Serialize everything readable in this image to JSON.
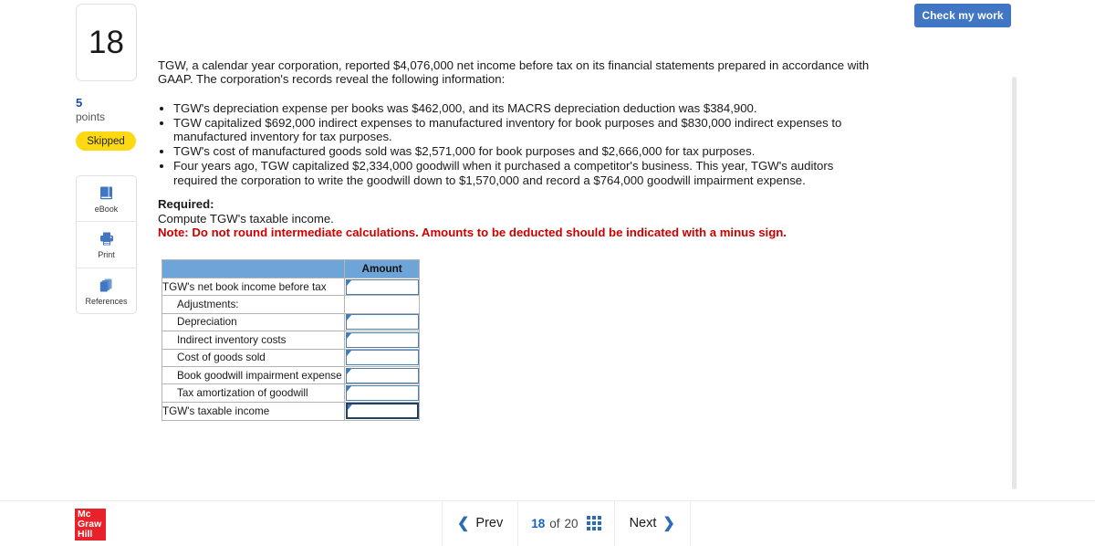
{
  "toolbar": {
    "check_work_label": "Check my work"
  },
  "question": {
    "number": "18",
    "points_value": "5",
    "points_label": "points",
    "status_badge": "Skipped"
  },
  "tools": [
    {
      "icon": "book-icon",
      "label": "eBook"
    },
    {
      "icon": "printer-icon",
      "label": "Print"
    },
    {
      "icon": "copy-pages-icon",
      "label": "References"
    }
  ],
  "content": {
    "intro": "TGW, a calendar year corporation, reported $4,076,000 net income before tax on its financial statements prepared in accordance with GAAP. The corporation's records reveal the following information:",
    "bullets": [
      "TGW's depreciation expense per books was $462,000, and its MACRS depreciation deduction was $384,900.",
      "TGW capitalized $692,000 indirect expenses to manufactured inventory for book purposes and $830,000 indirect expenses to manufactured inventory for tax purposes.",
      "TGW's cost of manufactured goods sold was $2,571,000 for book purposes and $2,666,000 for tax purposes.",
      "Four years ago, TGW capitalized $2,334,000 goodwill when it purchased a competitor's business. This year, TGW's auditors required the corporation to write the goodwill down to $1,570,000 and record a $764,000 goodwill impairment expense."
    ],
    "required_label": "Required:",
    "required_text": "Compute TGW's taxable income.",
    "note": "Note: Do not round intermediate calculations. Amounts to be deducted should be indicated with a minus sign."
  },
  "answer_table": {
    "header_blank": "",
    "header_amount": "Amount",
    "rows": [
      {
        "label": "TGW's net book income before tax",
        "indent": 0,
        "input": true,
        "value": "",
        "total": false
      },
      {
        "label": "Adjustments:",
        "indent": 1,
        "input": false,
        "value": "",
        "total": false
      },
      {
        "label": "Depreciation",
        "indent": 1,
        "input": true,
        "value": "",
        "total": false
      },
      {
        "label": "Indirect inventory costs",
        "indent": 1,
        "input": true,
        "value": "",
        "total": false
      },
      {
        "label": "Cost of goods sold",
        "indent": 1,
        "input": true,
        "value": "",
        "total": false
      },
      {
        "label": "Book goodwill impairment expense",
        "indent": 1,
        "input": true,
        "value": "",
        "total": false
      },
      {
        "label": "Tax amortization of goodwill",
        "indent": 1,
        "input": true,
        "value": "",
        "total": false
      },
      {
        "label": "TGW's taxable income",
        "indent": 0,
        "input": true,
        "value": "",
        "total": true
      }
    ]
  },
  "footer": {
    "logo_text": "Mc\nGraw\nHill",
    "logo_lines": [
      "Mc",
      "Graw",
      "Hill"
    ],
    "prev_label": "Prev",
    "next_label": "Next",
    "current_page": "18",
    "of_label": "of",
    "total_pages": "20",
    "grid_icon": "grid-menu-icon",
    "prev_icon": "chevron-left-icon",
    "next_icon": "chevron-right-icon"
  },
  "colors": {
    "accent_blue": "#4176c4",
    "link_blue": "#1565c0",
    "table_header": "#6ea5d8",
    "note_red": "#cc0000",
    "badge_yellow": "#fcd913",
    "logo_red": "#e8222a"
  }
}
